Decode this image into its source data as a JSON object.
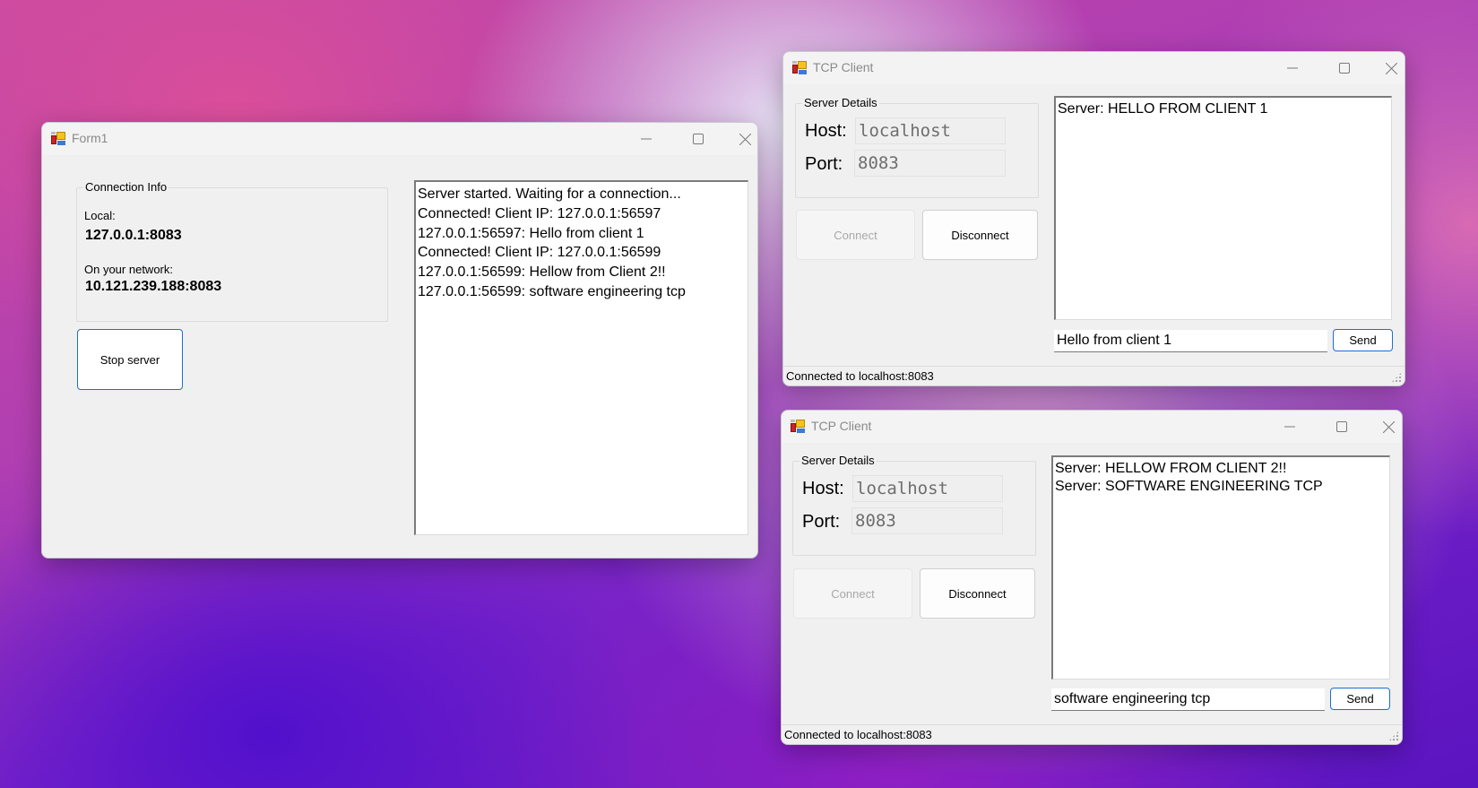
{
  "server_window": {
    "title": "Form1",
    "icon": "winforms-app-icon",
    "connection_info": {
      "group_label": "Connection Info",
      "local_label": "Local:",
      "local_value": "127.0.0.1:8083",
      "network_label": "On your network:",
      "network_value": "10.121.239.188:8083"
    },
    "stop_button_label": "Stop server",
    "log": [
      "Server started. Waiting for a connection...",
      "Connected! Client IP: 127.0.0.1:56597",
      "127.0.0.1:56597: Hello from client 1",
      "Connected! Client IP: 127.0.0.1:56599",
      "127.0.0.1:56599: Hellow from Client 2!!",
      "127.0.0.1:56599: software engineering tcp"
    ]
  },
  "clients": [
    {
      "title": "TCP Client",
      "icon": "winforms-app-icon",
      "server_details": {
        "group_label": "Server Details",
        "host_label": "Host:",
        "host_value": "localhost",
        "port_label": "Port:",
        "port_value": "8083"
      },
      "connect_label": "Connect",
      "disconnect_label": "Disconnect",
      "messages": [
        "Server: HELLO FROM CLIENT 1"
      ],
      "message_input_value": "Hello from client 1",
      "send_label": "Send",
      "status": "Connected to localhost:8083"
    },
    {
      "title": "TCP Client",
      "icon": "winforms-app-icon",
      "server_details": {
        "group_label": "Server Details",
        "host_label": "Host:",
        "host_value": "localhost",
        "port_label": "Port:",
        "port_value": "8083"
      },
      "connect_label": "Connect",
      "disconnect_label": "Disconnect",
      "messages": [
        "Server: HELLOW FROM CLIENT 2!!",
        "Server: SOFTWARE ENGINEERING TCP"
      ],
      "message_input_value": "software engineering tcp",
      "send_label": "Send",
      "status": "Connected to localhost:8083"
    }
  ]
}
